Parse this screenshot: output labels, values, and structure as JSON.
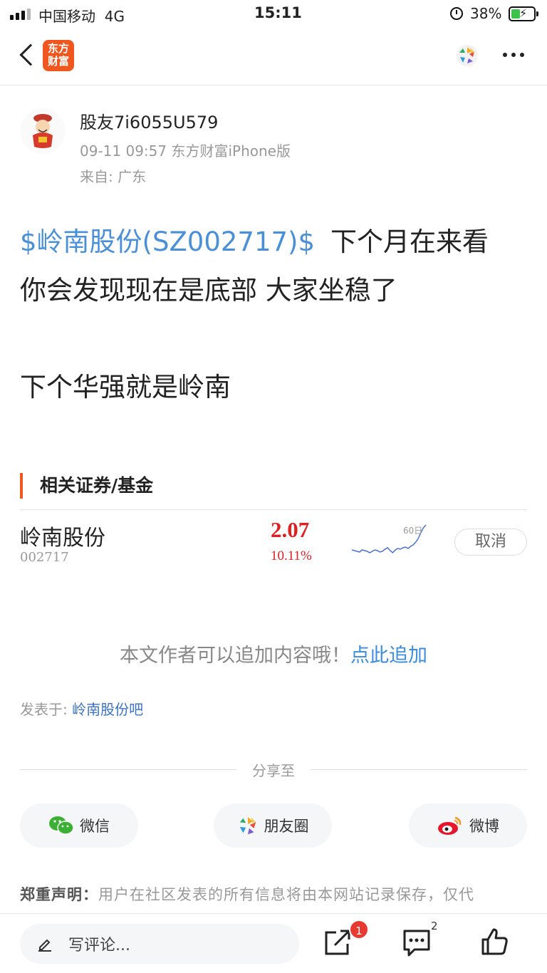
{
  "status_bar": {
    "carrier": "中国移动",
    "network": "4G",
    "time": "15:11",
    "battery": "38%"
  },
  "nav": {
    "brand_line1": "东方",
    "brand_line2": "财富",
    "brand_color": "#f0571f"
  },
  "post": {
    "author": "股友7i6055U579",
    "meta": "09-11 09:57 东方财富iPhone版",
    "location": "来自: 广东",
    "stock_tag": "$岭南股份(SZ002717)$",
    "line1_rest": "下个月在来看",
    "line2": "你会发现现在是底部 大家坐稳了",
    "line3": "下个华强就是岭南"
  },
  "related": {
    "title": "相关证券/基金",
    "security": {
      "name": "岭南股份",
      "code": "002717",
      "price": "2.07",
      "change": "10.11%",
      "spark_label": "60日",
      "spark_values": [
        0.3,
        0.28,
        0.26,
        0.24,
        0.3,
        0.28,
        0.26,
        0.22,
        0.26,
        0.3,
        0.28,
        0.24,
        0.26,
        0.32,
        0.36,
        0.28,
        0.22,
        0.3,
        0.34,
        0.32,
        0.36,
        0.38,
        0.34,
        0.4,
        0.44,
        0.52,
        0.62,
        0.78,
        0.92,
        1.0
      ],
      "cancel_label": "取消"
    }
  },
  "append": {
    "text": "本文作者可以追加内容哦！",
    "link": "点此追加"
  },
  "posted_in": {
    "prefix": "发表于:",
    "bar": "岭南股份吧"
  },
  "share": {
    "label": "分享至",
    "wechat": "微信",
    "moments": "朋友圈",
    "weibo": "微博"
  },
  "disclaimer": {
    "title": "郑重声明：",
    "text": "用户在社区发表的所有信息将由本网站记录保存，仅代"
  },
  "bottom": {
    "comment_placeholder": "写评论...",
    "share_badge": "1",
    "comment_count": "2"
  },
  "colors": {
    "accent": "#f0571f",
    "link": "#4a90d9",
    "up_red": "#e02020"
  }
}
